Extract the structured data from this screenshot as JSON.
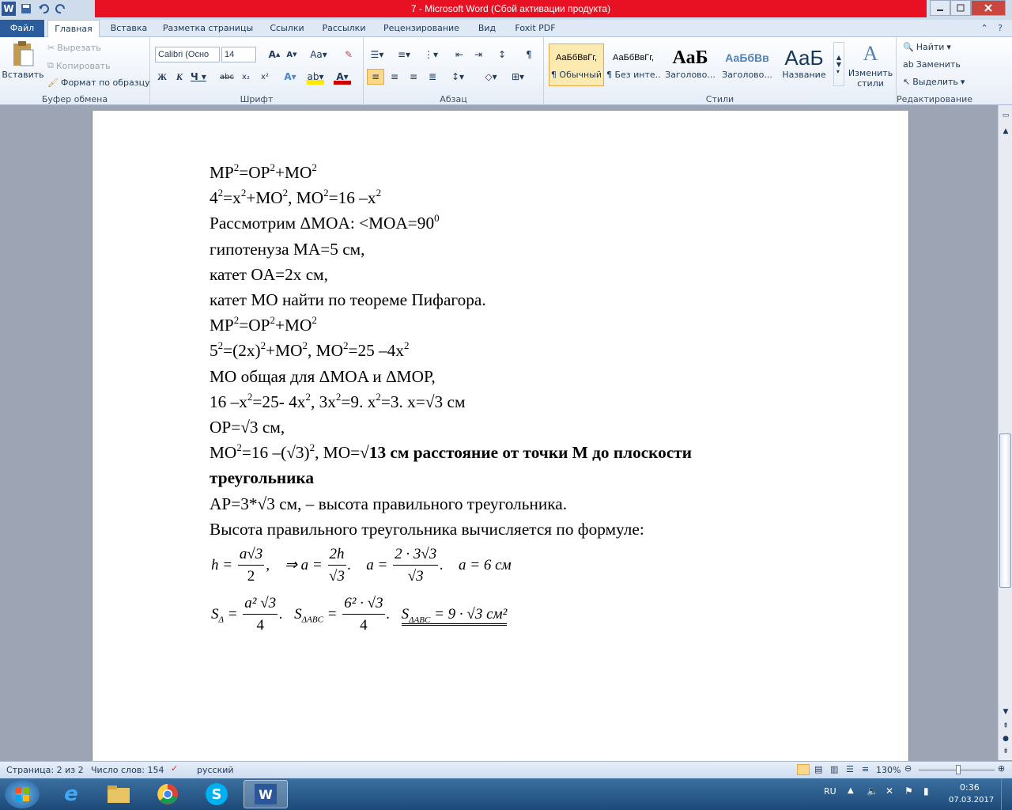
{
  "window": {
    "title": "7  -  Microsoft Word (Сбой активации продукта)",
    "app_icon": "W"
  },
  "tabs": [
    "Файл",
    "Главная",
    "Вставка",
    "Разметка страницы",
    "Ссылки",
    "Рассылки",
    "Рецензирование",
    "Вид",
    "Foxit PDF"
  ],
  "clipboard": {
    "paste": "Вставить",
    "cut": "Вырезать",
    "copy": "Копировать",
    "format_painter": "Формат по образцу",
    "label": "Буфер обмена"
  },
  "font": {
    "name": "Calibri (Осно",
    "size": "14",
    "label": "Шрифт"
  },
  "paragraph": {
    "label": "Абзац"
  },
  "styles": {
    "label": "Стили",
    "items": [
      {
        "preview": "АаБбВвГг,",
        "name": "¶ Обычный"
      },
      {
        "preview": "АаБбВвГг,",
        "name": "¶ Без инте..."
      },
      {
        "preview": "АаБ",
        "name": "Заголово..."
      },
      {
        "preview": "АаБбВв",
        "name": "Заголово..."
      },
      {
        "preview": "АаБ",
        "name": "Название"
      }
    ],
    "change": "Изменить стили"
  },
  "editing": {
    "find": "Найти",
    "replace": "Заменить",
    "select": "Выделить",
    "label": "Редактирование"
  },
  "doc": {
    "l1": "MP",
    "l1b": "=OP",
    "l1c": "+MO",
    "l2a": "4",
    "l2b": "=x",
    "l2c": "+MO",
    "l2d": ", MO",
    "l2e": "=16 –x",
    "l3a": "Рассмотрим ΔMOA: <MOA=90",
    "l4": "гипотенуза MA=5 см,",
    "l5": "катет OA=2x см,",
    "l6": "катет MO найти по теореме Пифагора.",
    "l7": "MP",
    "l7b": "=OP",
    "l7c": "+MO",
    "l8a": "5",
    "l8b": "=(2x)",
    "l8c": "+MO",
    "l8d": ", MO",
    "l8e": "=25 –4x",
    "l9": "MO общая для ΔMOA и ΔMOP,",
    "l10a": "16 –x",
    "l10b": "=25- 4x",
    "l10c": ", 3x",
    "l10d": "=9. x",
    "l10e": "=3. x=√3 см",
    "l11": "OP=√3 см,",
    "l12a": "MO",
    "l12b": "=16 –(√3)",
    "l12c": ", MO=√",
    "l12d": "13 см расстояние от точки M до плоскости",
    "l13": "треугольника",
    "l14": "AP=3*√3 см,  – высота правильного треугольника.",
    "l15": "Высота правильного треугольника вычисляется по формуле:",
    "sup2": "2",
    "sup0": "0"
  },
  "formulas": {
    "h": "h =",
    "h_num": "a√3",
    "h_den": "2",
    "comma": ",",
    "impl": "⇒ a =",
    "a_num": "2h",
    "a_den": "√3",
    "dot": ".",
    "a2": "a =",
    "a2_num": "2 · 3√3",
    "a2_den": "√3",
    "a_res": "a = 6 см",
    "s1": "S",
    "s1sub": "Δ",
    "s1_num": "a² √3",
    "s1_den": "4",
    "s2": "S",
    "s2sub": "ΔABC",
    "s2_num": "6² · √3",
    "s2_den": "4",
    "s3": "S",
    "s3sub": "ΔABC",
    "s3_rest": "= 9 · √3 см²"
  },
  "status": {
    "page": "Страница: 2 из 2",
    "words": "Число слов: 154",
    "lang": "русский",
    "zoom": "130%"
  },
  "taskbar": {
    "lang": "RU",
    "time": "0:36",
    "date": "07.03.2017"
  }
}
